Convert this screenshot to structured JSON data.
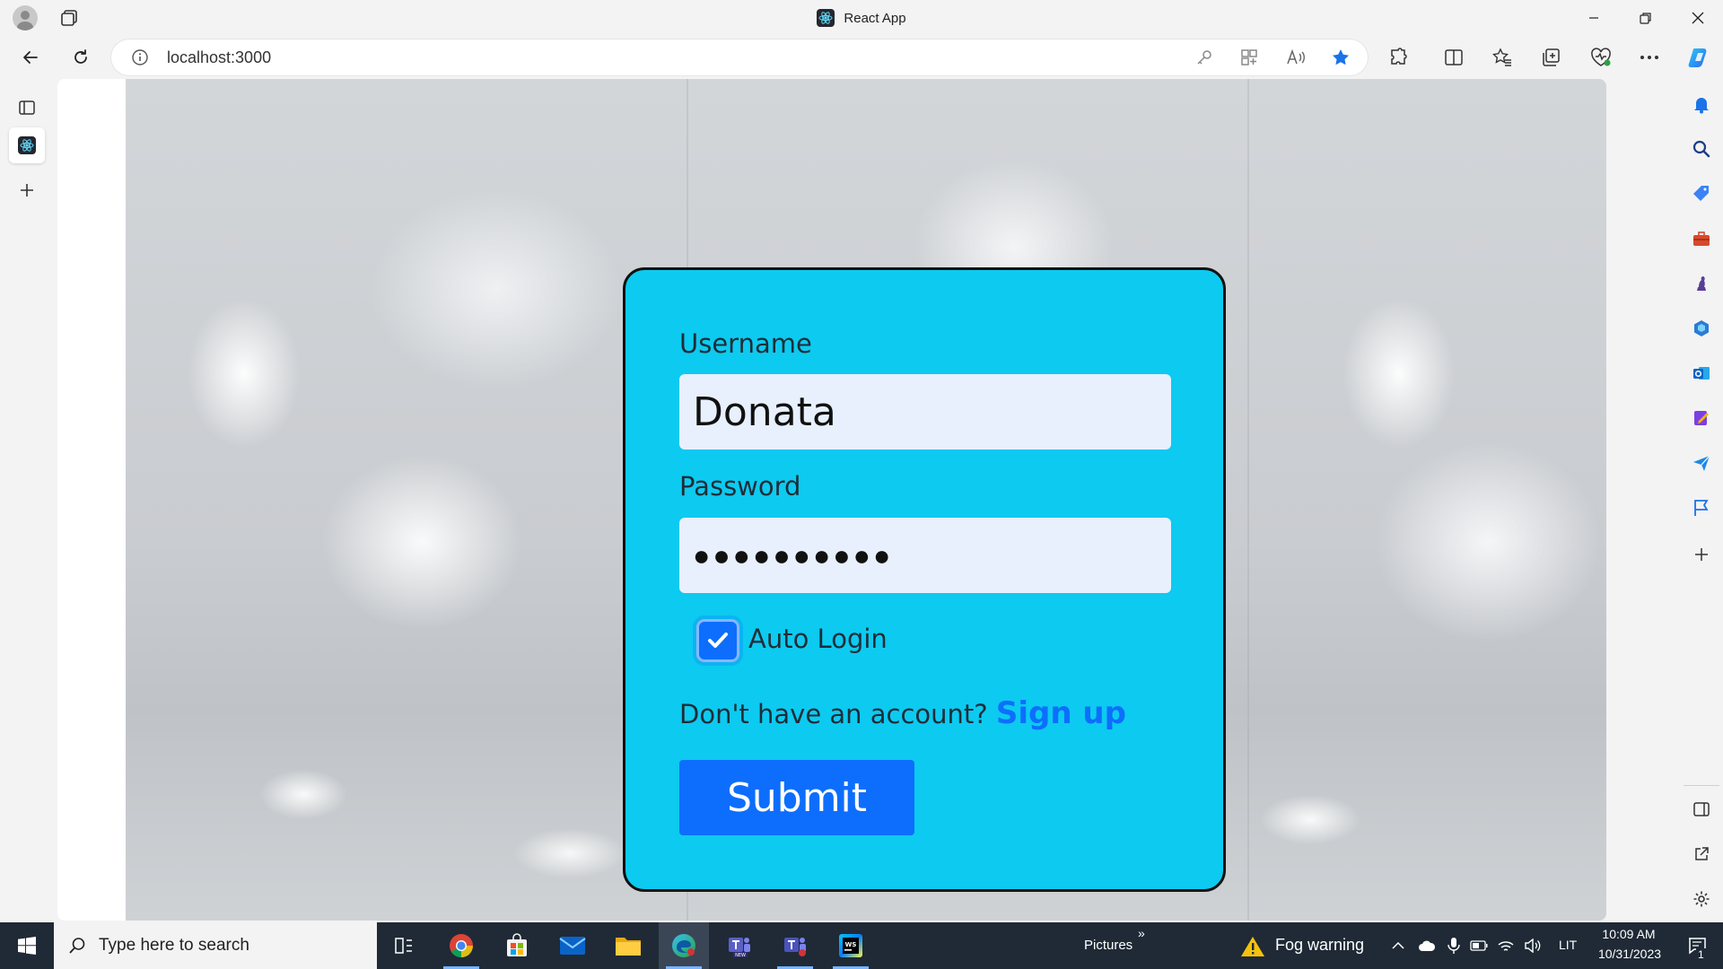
{
  "window": {
    "title": "React App"
  },
  "toolbar": {
    "url": "localhost:3000"
  },
  "form": {
    "username_label": "Username",
    "username_value": "Donata",
    "password_label": "Password",
    "password_masked": "●●●●●●●●●●",
    "auto_login_label": "Auto Login",
    "auto_login_checked": true,
    "signup_prompt": "Don't have an account?",
    "signup_link": "Sign up",
    "submit_label": "Submit"
  },
  "colors": {
    "card_bg": "#0dcaf0",
    "primary": "#0d6efd",
    "input_bg": "#e8f0fe"
  },
  "taskbar": {
    "search_placeholder": "Type here to search",
    "folder_label": "Pictures",
    "weather_label": "Fog warning",
    "language": "LIT",
    "time": "10:09 AM",
    "date": "10/31/2023",
    "notification_count": "1"
  }
}
